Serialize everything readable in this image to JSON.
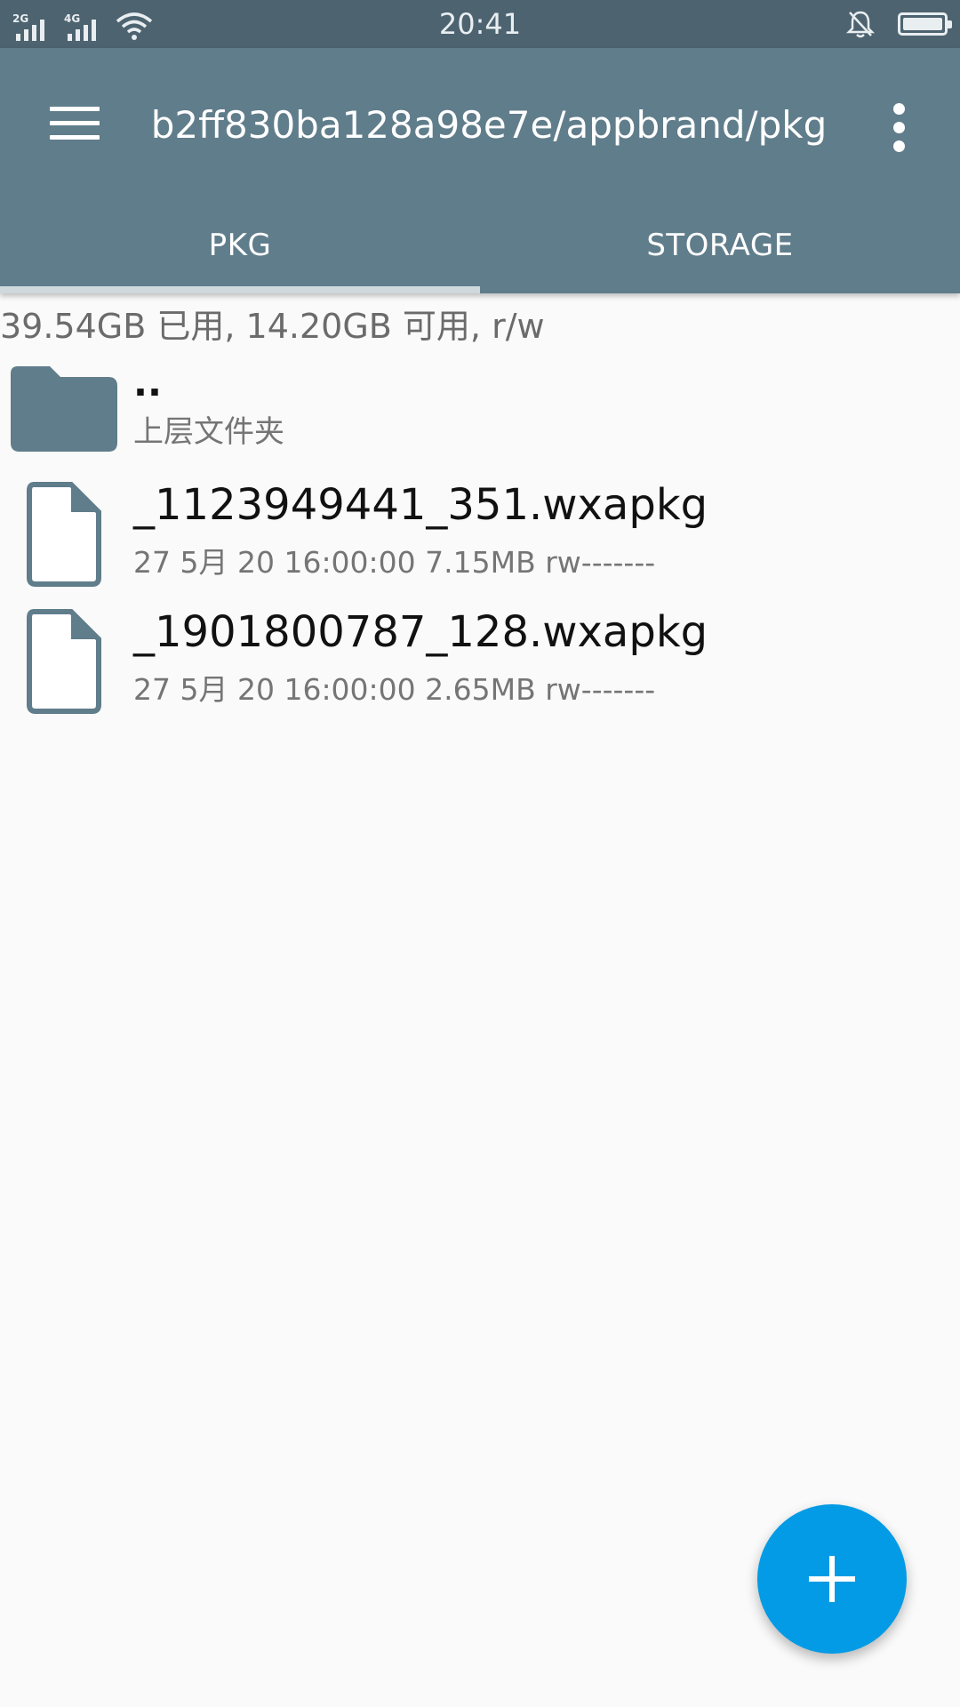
{
  "status_bar": {
    "network_1": "2G",
    "network_2": "4G",
    "time": "20:41",
    "icons": [
      "signal-2g-icon",
      "signal-4g-icon",
      "wifi-icon",
      "notifications-off-icon",
      "battery-icon"
    ]
  },
  "appbar": {
    "title": "b2ff830ba128a98e7e/appbrand/pkg",
    "tabs": [
      {
        "label": "PKG",
        "active": true
      },
      {
        "label": "STORAGE",
        "active": false
      }
    ],
    "color": "#607d8b"
  },
  "storage": {
    "info": "39.54GB 已用, 14.20GB 可用, r/w"
  },
  "files": [
    {
      "name": "..",
      "sub": "上层文件夹",
      "type": "folder"
    },
    {
      "name": "_1123949441_351.wxapkg",
      "sub": "27 5月 20 16:00:00  7.15MB  rw-------",
      "type": "file"
    },
    {
      "name": "_1901800787_128.wxapkg",
      "sub": "27 5月 20 16:00:00  2.65MB  rw-------",
      "type": "file"
    }
  ],
  "fab": {
    "icon": "plus-icon",
    "color": "#039be5"
  }
}
